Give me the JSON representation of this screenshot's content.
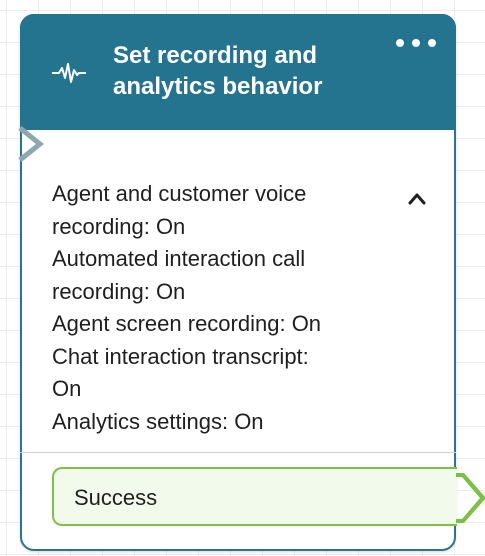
{
  "block": {
    "title_line1": "Set recording and",
    "title_line2": "analytics behavior",
    "icon": "waveform-icon",
    "menu_icon": "more-dots-icon",
    "settings": [
      "Agent and customer voice",
      "recording: On",
      "Automated interaction call",
      "recording: On",
      "Agent screen recording: On",
      "Chat interaction transcript:",
      "On",
      "Analytics settings: On"
    ],
    "collapse_icon": "chevron-up-icon",
    "branch_label": "Success"
  },
  "colors": {
    "header": "#24738f",
    "branch_border": "#7cc04a",
    "branch_fill": "#f2faeb",
    "notch": "#8fa6b3"
  }
}
